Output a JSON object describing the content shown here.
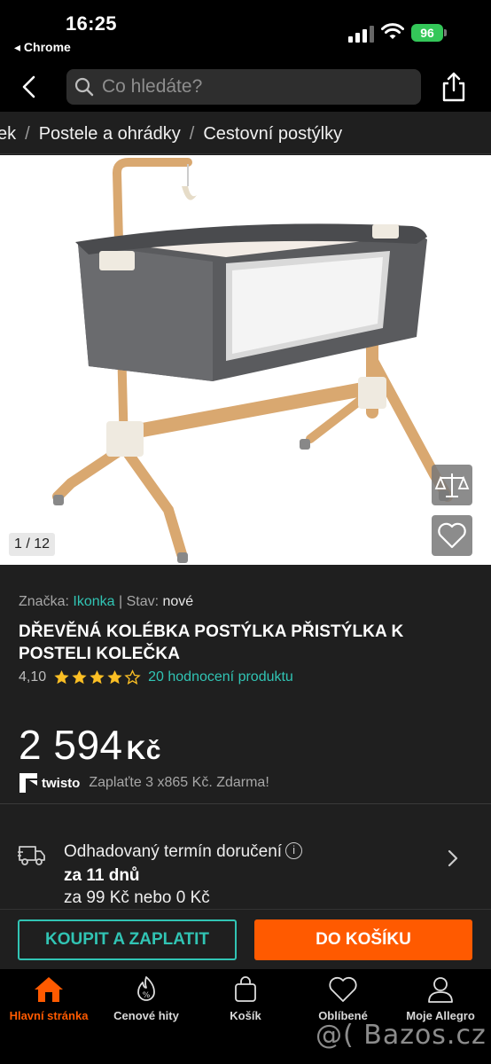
{
  "status_bar": {
    "time": "16:25",
    "back_app": "◂ Chrome",
    "battery": "96"
  },
  "search": {
    "placeholder": "Co hledáte?"
  },
  "breadcrumb": [
    "ek",
    "Postele a ohrádky",
    "Cestovní postýlky"
  ],
  "gallery": {
    "counter": "1 / 12"
  },
  "product": {
    "brand_label": "Značka:",
    "brand": "Ikonka",
    "separator": "|",
    "condition_label": "Stav:",
    "condition": "nové",
    "title": "DŘEVĚNÁ KOLÉBKA POSTÝLKA PŘISTÝLKA K POSTELI KOLEČKA",
    "rating_value": "4,10",
    "rating_stars": 4.1,
    "rating_count": "20 hodnocení produktu",
    "price_amount": "2 594",
    "price_currency": "Kč",
    "twisto_brand": "twisto",
    "twisto_text": "Zaplaťte 3 x865 Kč. Zdarma!"
  },
  "delivery": {
    "title": "Odhadovaný termín doručení",
    "info": "i",
    "days": "za 11 dnů",
    "price": "za 99 Kč nebo 0 Kč"
  },
  "actions": {
    "buy": "KOUPIT A ZAPLATIT",
    "cart": "DO KOŠÍKU"
  },
  "tabs": [
    {
      "label": "Hlavní stránka",
      "icon": "home-icon",
      "active": true
    },
    {
      "label": "Cenové hity",
      "icon": "price-hits-icon",
      "active": false
    },
    {
      "label": "Košík",
      "icon": "cart-icon",
      "active": false
    },
    {
      "label": "Oblíbené",
      "icon": "heart-icon",
      "active": false
    },
    {
      "label": "Moje Allegro",
      "icon": "user-icon",
      "active": false
    }
  ],
  "watermark": "@( Bazos.cz",
  "colors": {
    "accent_teal": "#31c4b4",
    "accent_orange": "#ff5a00",
    "battery": "#34c759"
  }
}
